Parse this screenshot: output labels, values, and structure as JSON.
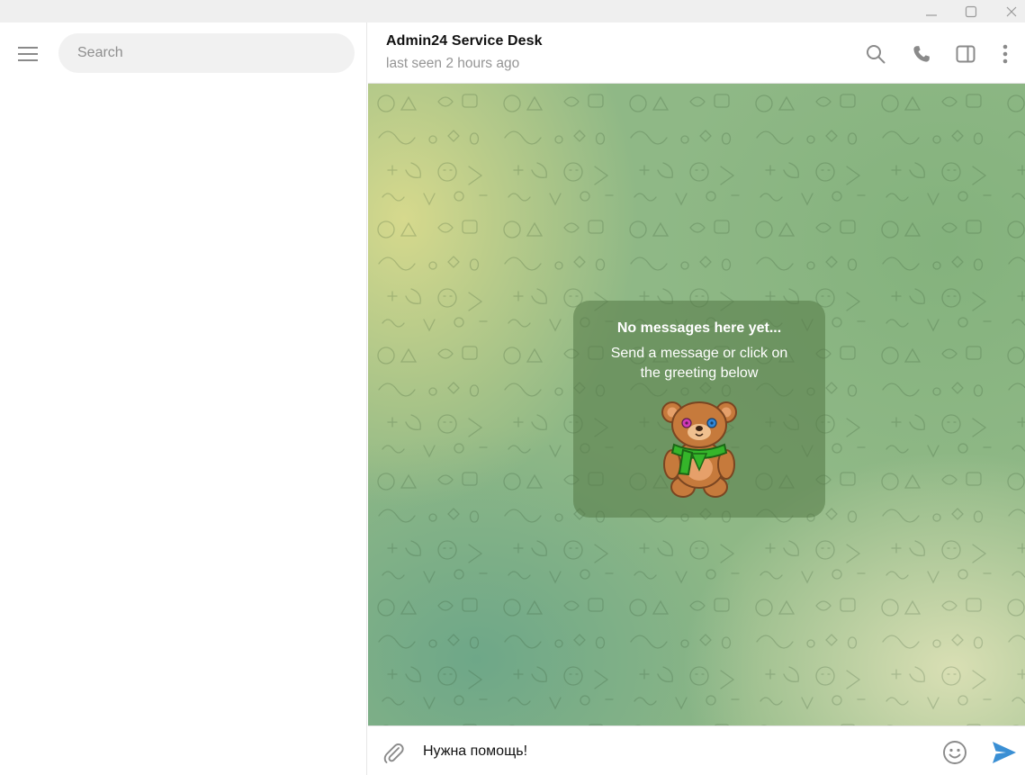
{
  "colors": {
    "accent": "#3a8fd4",
    "icon_gray": "#8a8a8a",
    "titlebar_bg": "#efefef",
    "search_bg": "#f1f1f1"
  },
  "window_controls": {
    "minimize_icon": "minimize-icon",
    "maximize_icon": "maximize-icon",
    "close_icon": "close-icon"
  },
  "sidebar": {
    "menu_icon": "hamburger-menu-icon",
    "search": {
      "placeholder": "Search",
      "value": ""
    }
  },
  "chat_header": {
    "title": "Admin24 Service Desk",
    "status": "last seen 2 hours ago",
    "icons": [
      "search-icon",
      "phone-icon",
      "sidebar-toggle-icon",
      "more-vertical-icon"
    ]
  },
  "empty_state": {
    "title": "No messages here yet...",
    "subtitle": "Send a message or click on the greeting below",
    "sticker": "teddy-bear-sticker"
  },
  "composer": {
    "value": "Нужна помощь!",
    "icons": [
      "paperclip-icon",
      "emoji-icon",
      "send-icon"
    ]
  }
}
